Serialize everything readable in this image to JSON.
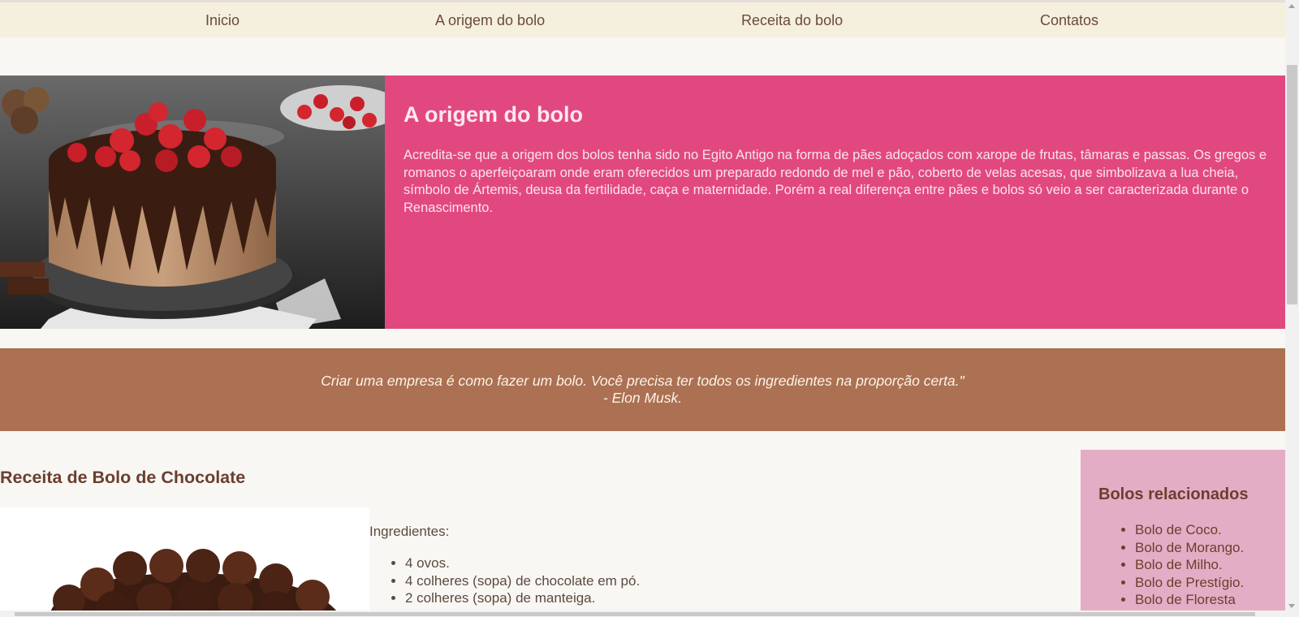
{
  "nav": {
    "items": [
      {
        "label": "Inicio"
      },
      {
        "label": "A origem do bolo"
      },
      {
        "label": "Receita do bolo"
      },
      {
        "label": "Contatos"
      }
    ]
  },
  "hero": {
    "image_icon": "chocolate-strawberry-cake-photo",
    "title": "A origem do bolo",
    "text": "Acredita-se que a origem dos bolos tenha sido no Egito Antigo na forma de pães adoçados com xarope de frutas, tâmaras e passas. Os gregos e romanos o aperfeiçoaram onde eram oferecidos um preparado redondo de mel e pão, coberto de velas acesas, que simbolizava a lua cheia, símbolo de Ártemis, deusa da fertilidade, caça e maternidade. Porém a real diferença entre pães e bolos só veio a ser caracterizada durante o Renascimento.",
    "bg_color": "#e24880"
  },
  "quote": {
    "line1": "Criar uma empresa é como fazer um bolo. Você precisa ter todos os ingredientes na proporção certa.\"",
    "line2": "- Elon Musk.",
    "bg_color": "#ab7152"
  },
  "recipe": {
    "title": "Receita de Bolo de Chocolate",
    "image_icon": "brigadeiro-cake-photo",
    "ingredients_label": "Ingredientes:",
    "ingredients": [
      "4 ovos.",
      "4 colheres (sopa) de chocolate em pó.",
      "2 colheres (sopa) de manteiga."
    ]
  },
  "sidebar": {
    "title": "Bolos relacionados",
    "items": [
      "Bolo de Coco.",
      "Bolo de Morango.",
      "Bolo de Milho.",
      "Bolo de Prestígio.",
      "Bolo de Floresta"
    ],
    "bg_color": "#e3adc5"
  }
}
